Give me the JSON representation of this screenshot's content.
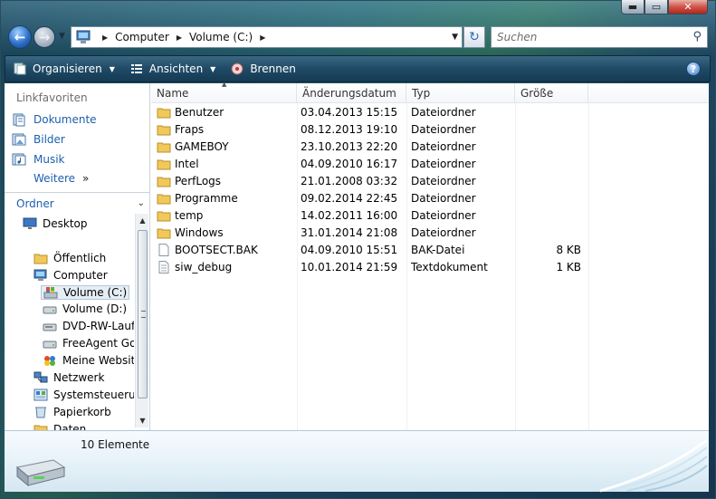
{
  "window": {
    "caption_buttons": {
      "minimize": "▬",
      "maximize": "▭",
      "close": "✕"
    }
  },
  "address_bar": {
    "crumbs": [
      "Computer",
      "Volume (C:)"
    ],
    "search_placeholder": "Suchen"
  },
  "toolbar": {
    "organize_label": "Organisieren",
    "views_label": "Ansichten",
    "burn_label": "Brennen"
  },
  "nav_pane": {
    "favorites_title": "Linkfavoriten",
    "favorites": [
      {
        "label": "Dokumente",
        "icon": "documents-icon"
      },
      {
        "label": "Bilder",
        "icon": "pictures-icon"
      },
      {
        "label": "Musik",
        "icon": "music-icon"
      }
    ],
    "more_label": "Weitere",
    "more_arrow": "»",
    "folders_label": "Ordner",
    "tree": [
      {
        "label": "Desktop",
        "icon": "desktop-icon"
      },
      {
        "label": "Öffentlich",
        "icon": "folder-icon"
      },
      {
        "label": "Computer",
        "icon": "computer-icon"
      },
      {
        "label": "Volume (C:)",
        "icon": "windows-drive-icon",
        "selected": true
      },
      {
        "label": "Volume (D:)",
        "icon": "drive-icon"
      },
      {
        "label": "DVD-RW-Laufw",
        "icon": "dvd-drive-icon"
      },
      {
        "label": "FreeAgent GoF",
        "icon": "drive-icon"
      },
      {
        "label": "Meine Website",
        "icon": "msn-icon"
      },
      {
        "label": "Netzwerk",
        "icon": "network-icon"
      },
      {
        "label": "Systemsteuerung",
        "icon": "control-panel-icon"
      },
      {
        "label": "Papierkorb",
        "icon": "recycle-bin-icon"
      },
      {
        "label": "Daten",
        "icon": "folder-icon"
      }
    ]
  },
  "file_list": {
    "columns": [
      "Name",
      "Änderungsdatum",
      "Typ",
      "Größe"
    ],
    "rows": [
      {
        "name": "Benutzer",
        "date": "03.04.2013 15:15",
        "type": "Dateiordner",
        "size": "",
        "icon": "folder-icon"
      },
      {
        "name": "Fraps",
        "date": "08.12.2013 19:10",
        "type": "Dateiordner",
        "size": "",
        "icon": "folder-icon"
      },
      {
        "name": "GAMEBOY",
        "date": "23.10.2013 22:20",
        "type": "Dateiordner",
        "size": "",
        "icon": "folder-icon"
      },
      {
        "name": "Intel",
        "date": "04.09.2010 16:17",
        "type": "Dateiordner",
        "size": "",
        "icon": "folder-icon"
      },
      {
        "name": "PerfLogs",
        "date": "21.01.2008 03:32",
        "type": "Dateiordner",
        "size": "",
        "icon": "folder-icon"
      },
      {
        "name": "Programme",
        "date": "09.02.2014 22:45",
        "type": "Dateiordner",
        "size": "",
        "icon": "folder-icon"
      },
      {
        "name": "temp",
        "date": "14.02.2011 16:00",
        "type": "Dateiordner",
        "size": "",
        "icon": "folder-icon"
      },
      {
        "name": "Windows",
        "date": "31.01.2014 21:08",
        "type": "Dateiordner",
        "size": "",
        "icon": "folder-icon"
      },
      {
        "name": "BOOTSECT.BAK",
        "date": "04.09.2010 15:51",
        "type": "BAK-Datei",
        "size": "8 KB",
        "icon": "file-icon"
      },
      {
        "name": "siw_debug",
        "date": "10.01.2014 21:59",
        "type": "Textdokument",
        "size": "1 KB",
        "icon": "text-file-icon"
      }
    ]
  },
  "details_pane": {
    "count_label": "10 Elemente"
  }
}
